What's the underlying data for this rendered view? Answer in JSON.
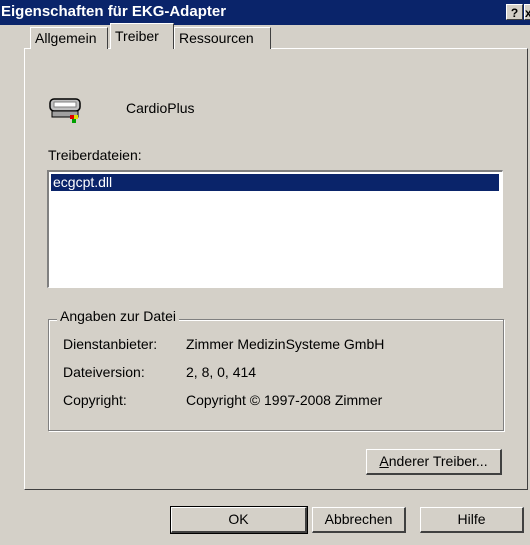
{
  "window": {
    "title": "Eigenschaften für EKG-Adapter",
    "help_btn": "?",
    "close_btn": "x"
  },
  "tabs": [
    {
      "label": "Allgemein"
    },
    {
      "label": "Treiber"
    },
    {
      "label": "Ressourcen"
    }
  ],
  "device": {
    "name": "CardioPlus",
    "icon": "ekg-adapter-icon"
  },
  "files": {
    "label": "Treiberdateien:",
    "items": [
      "ecgcpt.dll"
    ]
  },
  "file_info": {
    "title": "Angaben zur Datei",
    "provider_label": "Dienstanbieter:",
    "provider_value": "Zimmer MedizinSysteme GmbH",
    "version_label": "Dateiversion:",
    "version_value": "2, 8, 0, 414",
    "copyright_label": "Copyright:",
    "copyright_value": "Copyright © 1997-2008 Zimmer"
  },
  "buttons": {
    "change_driver_rest": "nderer Treiber...",
    "change_driver_accel": "A",
    "ok": "OK",
    "cancel": "Abbrechen",
    "help": "Hilfe"
  },
  "colors": {
    "titlebar": "#0a246a",
    "face": "#d4d0c8",
    "selection": "#0a246a"
  }
}
